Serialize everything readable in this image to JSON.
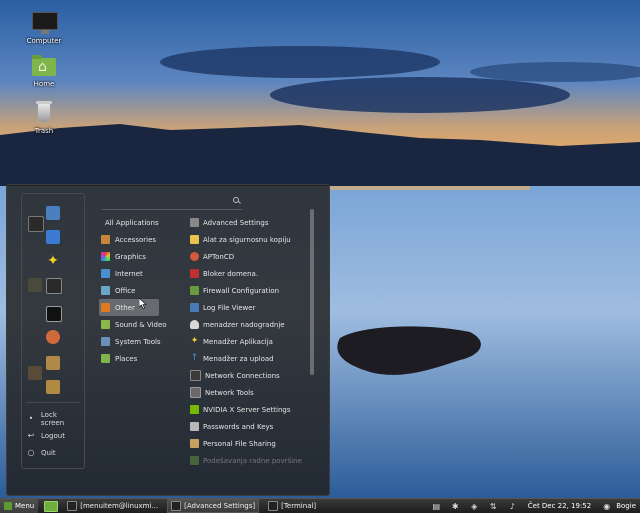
{
  "desktop": {
    "icons": [
      {
        "label": "Computer"
      },
      {
        "label": "Home"
      },
      {
        "label": "Trash"
      }
    ]
  },
  "menu": {
    "search": {
      "value": "",
      "placeholder": ""
    },
    "session": {
      "lock": "Lock screen",
      "logout": "Logout",
      "quit": "Quit"
    },
    "categories": [
      {
        "label": "All Applications",
        "color": ""
      },
      {
        "label": "Accessories",
        "color": "#c9863a"
      },
      {
        "label": "Graphics",
        "color": "#d24a9c"
      },
      {
        "label": "Internet",
        "color": "#4a8fd2"
      },
      {
        "label": "Office",
        "color": "#6aa6c9"
      },
      {
        "label": "Other",
        "color": "#e07a20"
      },
      {
        "label": "Sound & Video",
        "color": "#8ab84a"
      },
      {
        "label": "System Tools",
        "color": "#6a8fb8"
      },
      {
        "label": "Places",
        "color": "#7fb54a"
      }
    ],
    "selected_category": "Other",
    "apps": [
      {
        "label": "Advanced Settings",
        "color": "#888888"
      },
      {
        "label": "Alat za sigurnosnu kopiju",
        "color": "#e8c24a"
      },
      {
        "label": "APTonCD",
        "color": "#d05a3a"
      },
      {
        "label": "Bloker domena.",
        "color": "#c03030"
      },
      {
        "label": "Firewall Configuration",
        "color": "#6a9c3b"
      },
      {
        "label": "Log File Viewer",
        "color": "#4a7ab8"
      },
      {
        "label": "menadzer nadogradnje",
        "color": "#d8d8d8"
      },
      {
        "label": "Menadžer Aplikacija",
        "color": "#f0d030"
      },
      {
        "label": "Menadžer za upload",
        "color": "#4a90d9"
      },
      {
        "label": "Network Connections",
        "color": "#3a3a3a"
      },
      {
        "label": "Network Tools",
        "color": "#6a6a6a"
      },
      {
        "label": "NVIDIA X Server Settings",
        "color": "#76b900"
      },
      {
        "label": "Passwords and Keys",
        "color": "#b8b8b8"
      },
      {
        "label": "Personal File Sharing",
        "color": "#c8a060"
      },
      {
        "label": "Podešavanja radne površine",
        "color": "#7fb54a"
      }
    ]
  },
  "taskbar": {
    "menu_label": "Menu",
    "tasks": [
      {
        "label": "[menuitem@linuxmi...",
        "active": false
      },
      {
        "label": "[Advanced Settings]",
        "active": true
      },
      {
        "label": "[Terminal]",
        "active": false
      }
    ],
    "clock": "Čet Dec 22, 19:52",
    "user": "Bogie"
  }
}
